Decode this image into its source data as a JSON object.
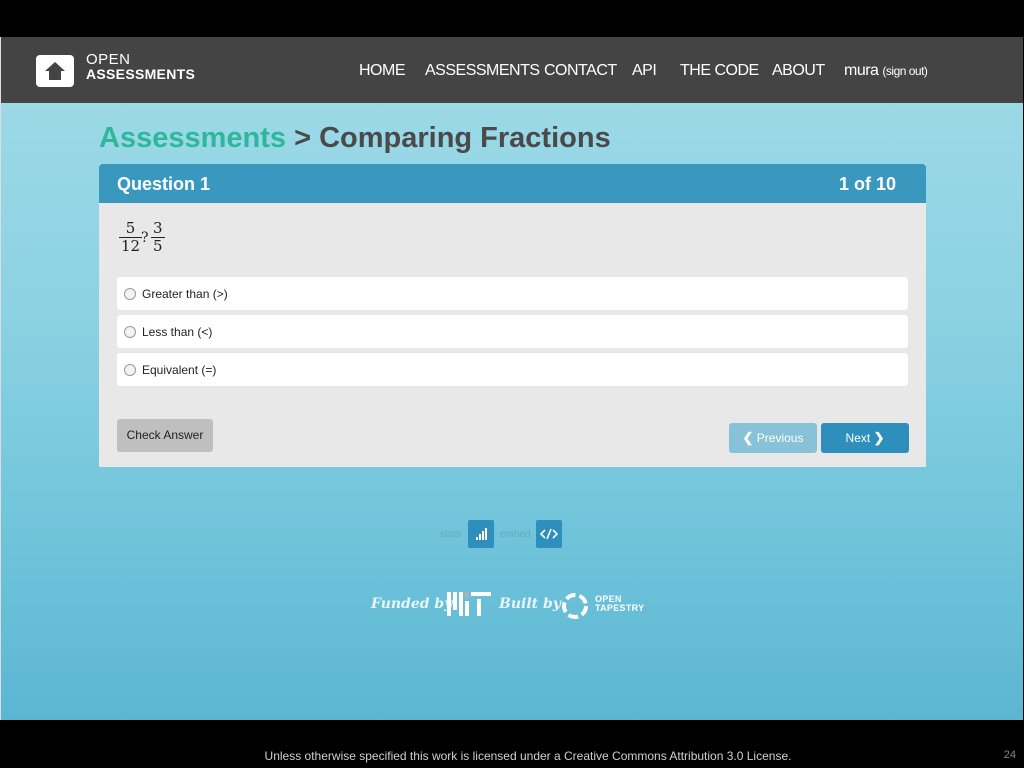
{
  "navbar": {
    "logo": {
      "line1": "OPEN",
      "line2": "ASSESSMENTS"
    },
    "links": [
      "HOME",
      "ASSESSMENTS",
      "CONTACT",
      "API",
      "THE CODE",
      "ABOUT"
    ],
    "user": {
      "name": "mura",
      "signout": "(sign out)"
    }
  },
  "breadcrumb": {
    "parent": "Assessments",
    "separator": ">",
    "current": "Comparing Fractions"
  },
  "question": {
    "title": "Question 1",
    "counter": "1 of 10",
    "expression": {
      "left_num": "5",
      "left_den": "12",
      "operator": "?",
      "right_num": "3",
      "right_den": "5"
    },
    "options": [
      "Greater than (>)",
      "Less than (<)",
      "Equivalent (=)"
    ],
    "check_label": "Check Answer",
    "previous_label": "Previous",
    "next_label": "Next"
  },
  "tools": {
    "stats": "stats",
    "embed": "embed"
  },
  "credits": {
    "funded_by": "Funded by",
    "built_by": "Built by",
    "tapestry_line1": "OPEN",
    "tapestry_line2": "TAPESTRY",
    "mit_logo": "MIT"
  },
  "footer": {
    "license": "Unless otherwise specified this work is licensed under a Creative Commons Attribution 3.0 License.",
    "page_number": "24"
  },
  "colors": {
    "navbar": "#444444",
    "accent_green": "#2fb79b",
    "header_blue": "#3a98be",
    "button_blue": "#2e8fbd"
  }
}
